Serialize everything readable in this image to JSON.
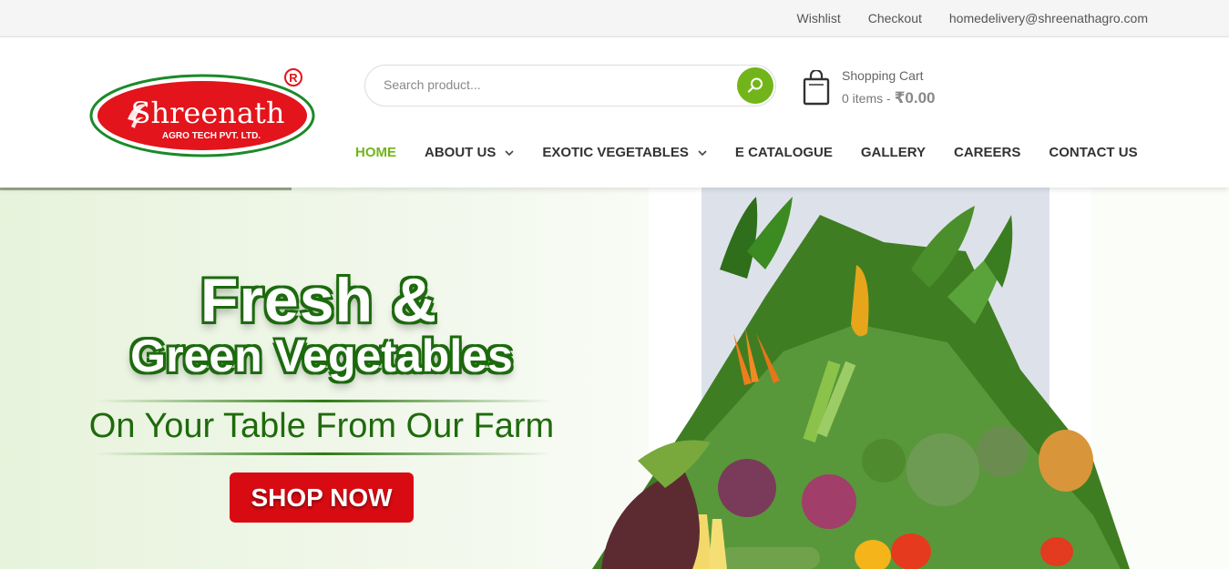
{
  "topbar": {
    "links": [
      "Wishlist",
      "Checkout",
      "homedelivery@shreenathagro.com"
    ]
  },
  "logo": {
    "brand": "Shreenath",
    "sub": "AGRO TECH PVT. LTD.",
    "registered": "R"
  },
  "search": {
    "placeholder": "Search product..."
  },
  "cart": {
    "title": "Shopping Cart",
    "items": "0 items -",
    "total": "₹0.00"
  },
  "nav": {
    "items": [
      {
        "label": "HOME",
        "active": true
      },
      {
        "label": "ABOUT US",
        "dropdown": true
      },
      {
        "label": "EXOTIC VEGETABLES",
        "dropdown": true
      },
      {
        "label": "E CATALOGUE"
      },
      {
        "label": "GALLERY"
      },
      {
        "label": "CAREERS"
      },
      {
        "label": "CONTACT US"
      }
    ]
  },
  "hero": {
    "headline1": "Fresh &",
    "headline2": "Green Vegetables",
    "tagline": "On Your Table From Our Farm",
    "cta": "SHOP NOW"
  },
  "colors": {
    "accent": "#72b51a",
    "brand_red": "#d90b12",
    "hero_green": "#1f6a0d"
  }
}
